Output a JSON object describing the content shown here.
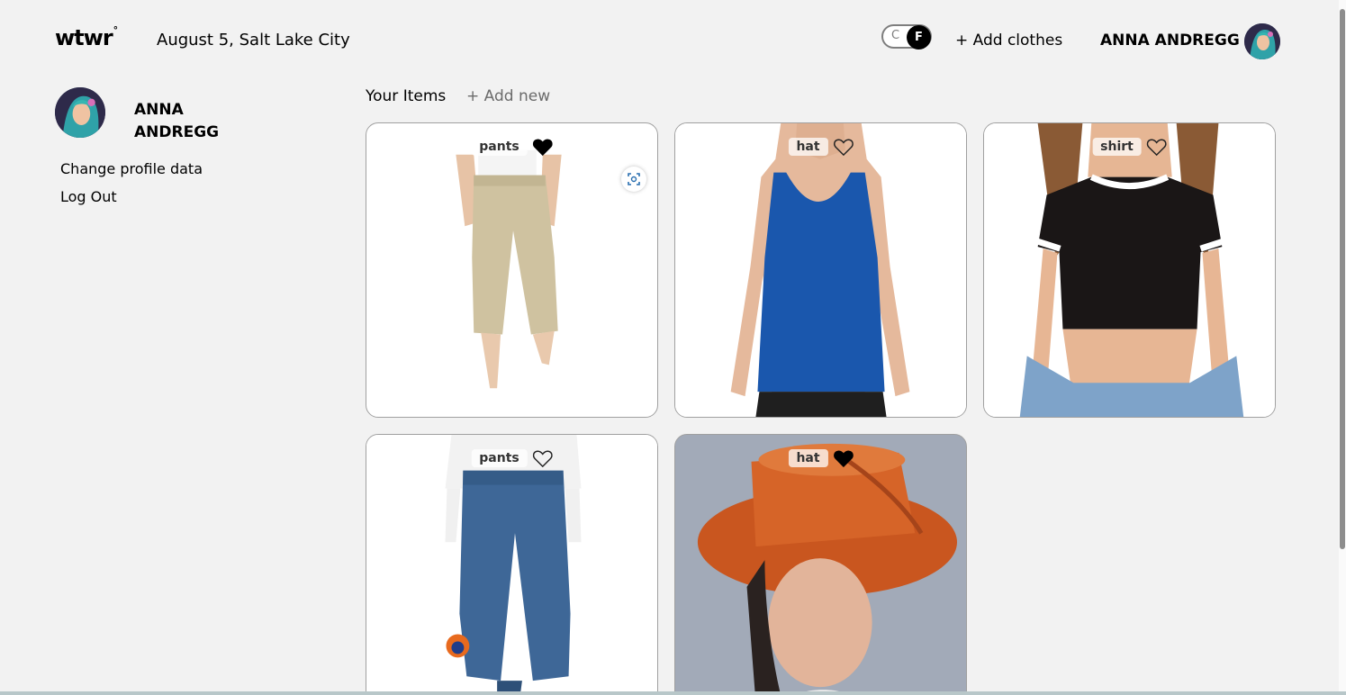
{
  "header": {
    "logo": "wtwr",
    "logo_mark": "°",
    "date_location": "August 5, Salt Lake City",
    "toggle": {
      "left": "C",
      "right": "F",
      "selected": "F"
    },
    "add_clothes_label": "+ Add clothes",
    "username": "ANNA ANDREGG"
  },
  "sidebar": {
    "name_line1": "ANNA",
    "name_line2": "ANDREGG",
    "change_profile_label": "Change profile data",
    "logout_label": "Log Out"
  },
  "main": {
    "section_title": "Your Items",
    "add_new_label": "+ Add new",
    "items": [
      {
        "type": "pants",
        "liked": true,
        "icon": "heart-icon"
      },
      {
        "type": "hat",
        "liked": false,
        "icon": "heart-icon"
      },
      {
        "type": "shirt",
        "liked": false,
        "icon": "heart-icon"
      },
      {
        "type": "pants",
        "liked": false,
        "icon": "heart-icon"
      },
      {
        "type": "hat",
        "liked": true,
        "icon": "heart-icon"
      }
    ]
  },
  "colors": {
    "background": "#f2f2f2",
    "text": "#000000",
    "muted": "#6b6b6b",
    "card_border": "#a0a0a0"
  }
}
